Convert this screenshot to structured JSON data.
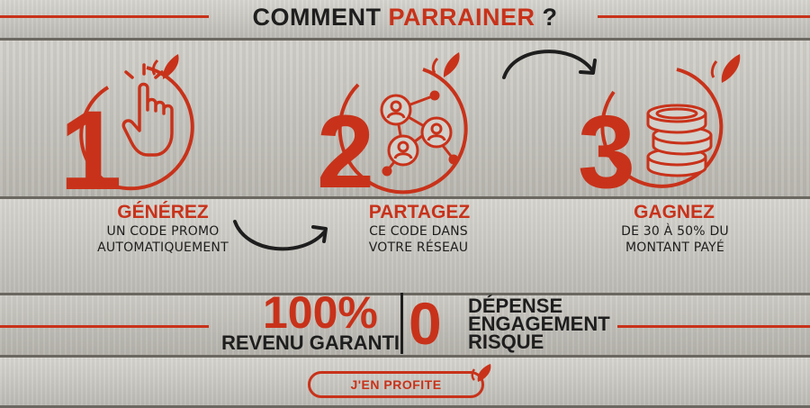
{
  "header": {
    "title_part1": "COMMENT ",
    "title_part2": "PARRAINER",
    "title_part3": " ?"
  },
  "steps": [
    {
      "number": "1",
      "title": "GÉNÉREZ",
      "desc_line1": "UN CODE PROMO",
      "desc_line2": "AUTOMATIQUEMENT",
      "icon": "pointing-hand-icon"
    },
    {
      "number": "2",
      "title": "PARTAGEZ",
      "desc_line1": "CE CODE DANS",
      "desc_line2": "VOTRE RÉSEAU",
      "icon": "network-share-icon"
    },
    {
      "number": "3",
      "title": "GAGNEZ",
      "desc_line1": "DE 30 À 50% DU",
      "desc_line2": "MONTANT PAYÉ",
      "icon": "coins-stack-icon"
    }
  ],
  "guarantee": {
    "percent": "100%",
    "revenue_label": "REVENU GARANTI",
    "zero": "0",
    "items": [
      "DÉPENSE",
      "ENGAGEMENT",
      "RISQUE"
    ]
  },
  "cta": {
    "label": "J'EN PROFITE"
  },
  "colors": {
    "accent": "#c8321a",
    "text": "#1e1e1e",
    "wood": "#c9c7c2"
  }
}
